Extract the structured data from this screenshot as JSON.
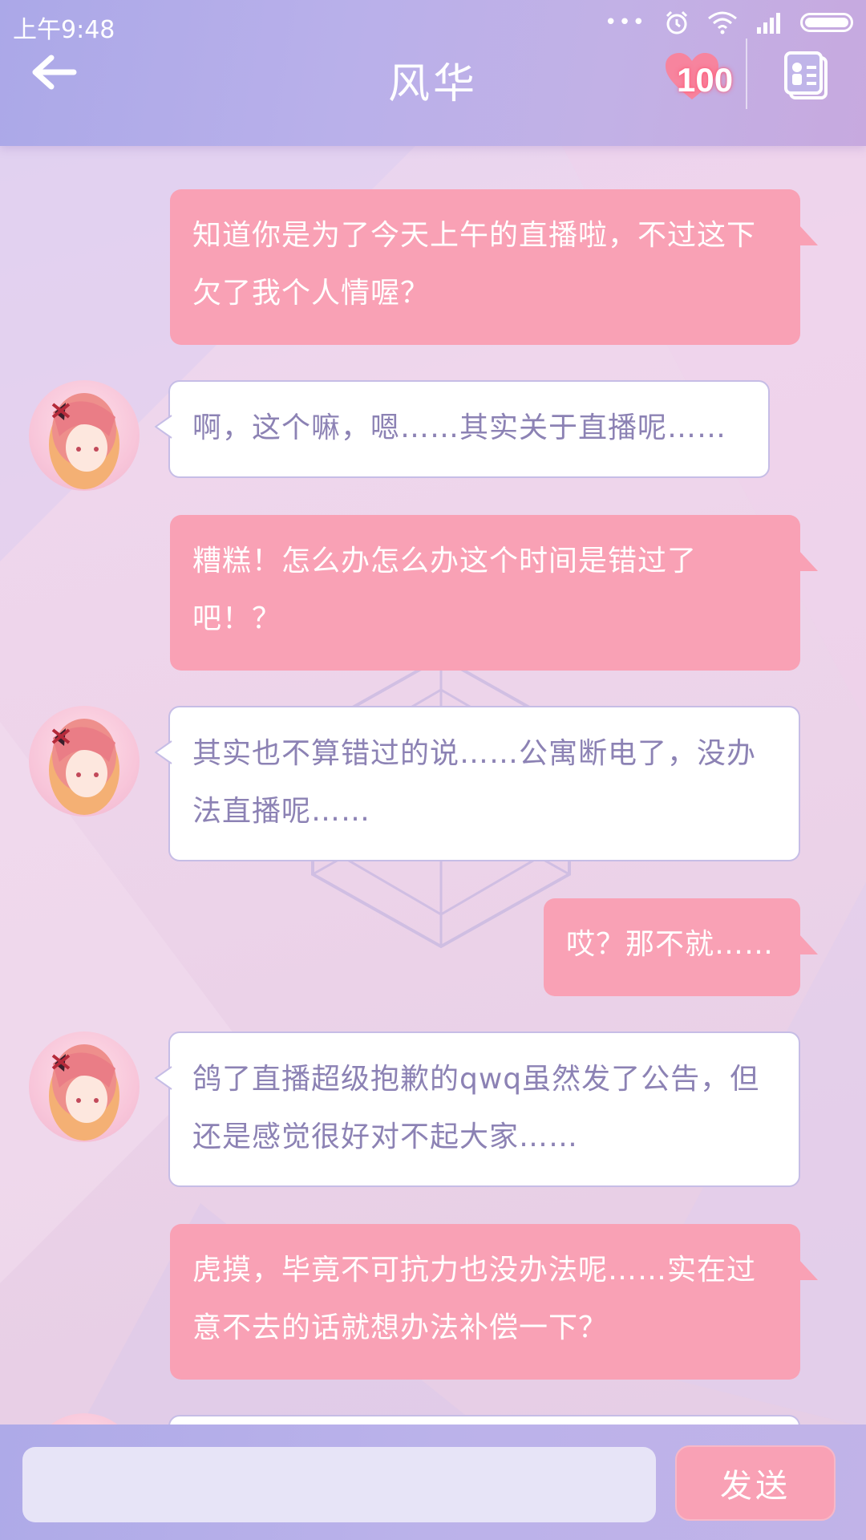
{
  "status_bar": {
    "time": "上午9:48"
  },
  "header": {
    "title": "风华",
    "favor_value": "100"
  },
  "messages": [
    {
      "side": "sent",
      "text": "知道你是为了今天上午的直播啦，不过这下欠了我个人情喔？"
    },
    {
      "side": "received",
      "text": "啊，这个嘛，嗯……其实关于直播呢……"
    },
    {
      "side": "sent",
      "text": "糟糕！怎么办怎么办这个时间是错过了吧！？"
    },
    {
      "side": "received",
      "text": "其实也不算错过的说……公寓断电了，没办法直播呢……"
    },
    {
      "side": "sent",
      "text": "哎？那不就……"
    },
    {
      "side": "received",
      "text": "鸽了直播超级抱歉的qwq虽然发了公告，但还是感觉很好对不起大家……"
    },
    {
      "side": "sent",
      "text": "虎摸，毕竟不可抗力也没办法呢……实在过意不去的话就想办法补偿一下？"
    }
  ],
  "input": {
    "placeholder": ""
  },
  "send_button": {
    "label": "发送"
  },
  "colors": {
    "header": "#b4aeea",
    "sent_bubble": "#f9a1b5",
    "received_bubble_text": "#8c82b4",
    "received_bubble_border": "#c6bde6"
  }
}
